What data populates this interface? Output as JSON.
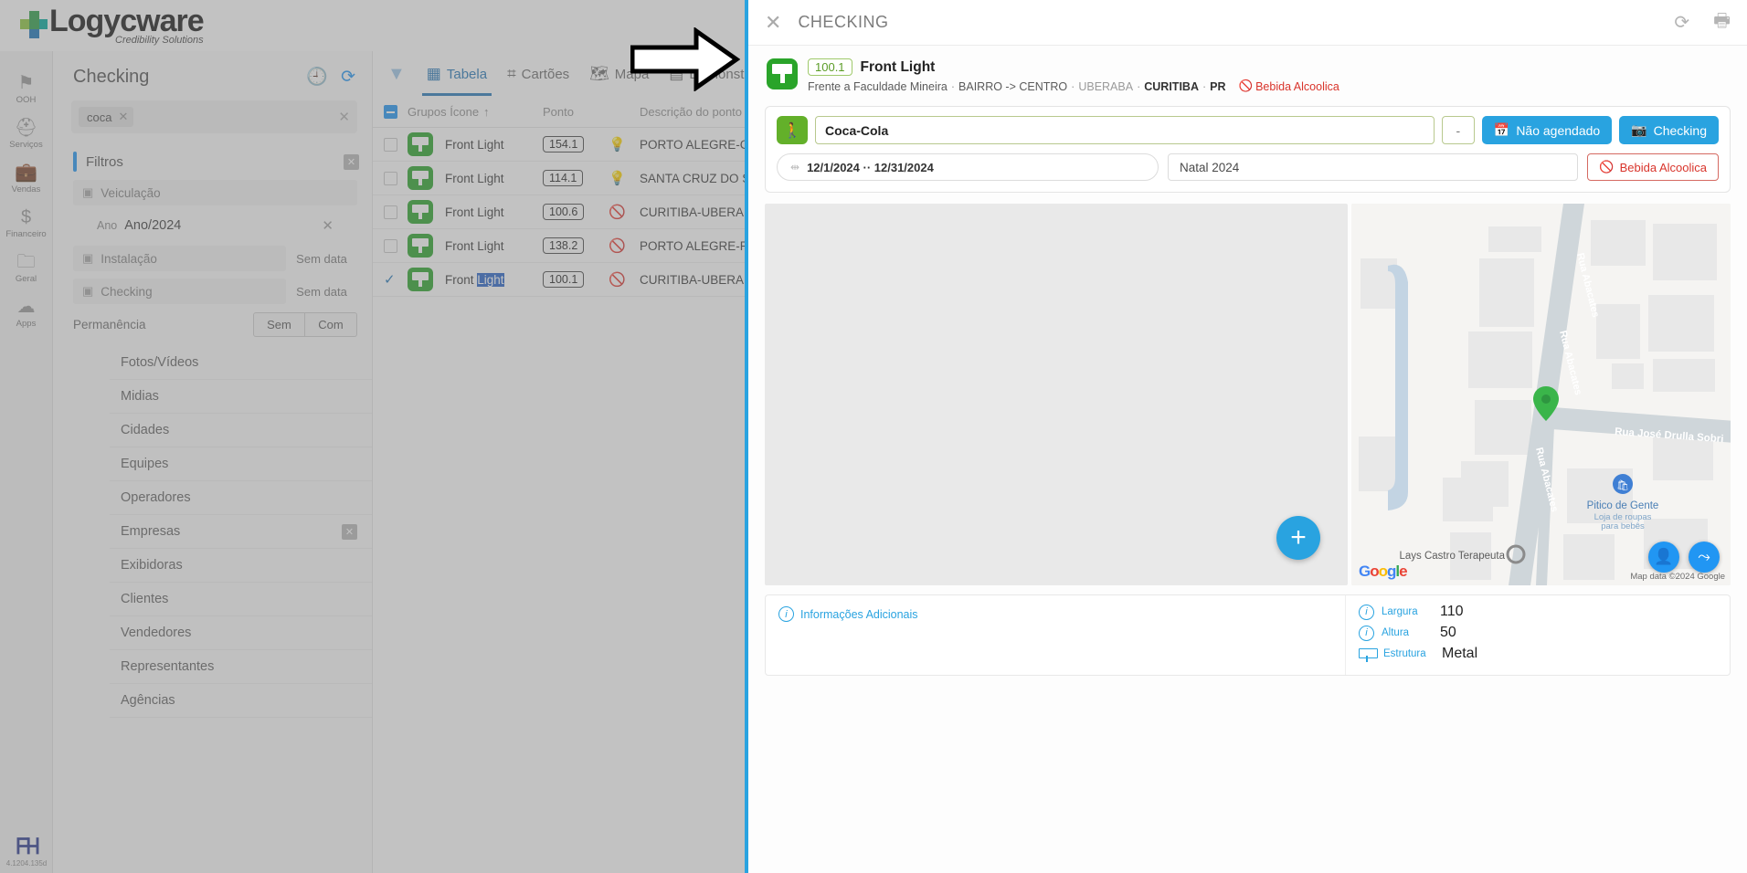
{
  "brand": {
    "name": "Logycware",
    "tagline": "Credibility Solutions"
  },
  "rail": {
    "items": [
      {
        "label": "OOH",
        "icon": "flag-icon"
      },
      {
        "label": "Serviços",
        "icon": "helmet-icon"
      },
      {
        "label": "Vendas",
        "icon": "briefcase-icon"
      },
      {
        "label": "Financeiro",
        "icon": "dollar-icon"
      },
      {
        "label": "Geral",
        "icon": "folder-icon"
      },
      {
        "label": "Apps",
        "icon": "cloud-plus-icon"
      }
    ],
    "version": "4.1204.135d"
  },
  "filters": {
    "page_title": "Checking",
    "history_icon": "history-icon",
    "refresh_icon": "refresh-icon",
    "search_chip": "coca",
    "search_clear": "✕",
    "section_title": "Filtros",
    "section_close": "✕",
    "veiculacao": {
      "label": "Veiculação",
      "ano_label": "Ano",
      "ano_value": "Ano/2024",
      "clear": "✕"
    },
    "instalacao": {
      "label": "Instalação",
      "value": "Sem data"
    },
    "checking": {
      "label": "Checking",
      "value": "Sem data"
    },
    "permanencia": {
      "label": "Permanência",
      "option_sem": "Sem",
      "option_com": "Com"
    },
    "accordions": [
      {
        "label": "Fotos/Vídeos",
        "has_close": false
      },
      {
        "label": "Midias",
        "has_close": false
      },
      {
        "label": "Cidades",
        "has_close": false
      },
      {
        "label": "Equipes",
        "has_close": false
      },
      {
        "label": "Operadores",
        "has_close": false
      },
      {
        "label": "Empresas",
        "has_close": true
      },
      {
        "label": "Exibidoras",
        "has_close": false
      },
      {
        "label": "Clientes",
        "has_close": false
      },
      {
        "label": "Vendedores",
        "has_close": false
      },
      {
        "label": "Representantes",
        "has_close": false
      },
      {
        "label": "Agências",
        "has_close": false
      }
    ]
  },
  "table": {
    "filter_icon": "funnel-icon",
    "tabs": [
      {
        "label": "Tabela",
        "icon": "grid-table-icon",
        "active": true
      },
      {
        "label": "Cartões",
        "icon": "cards-icon",
        "active": false
      },
      {
        "label": "Mapa",
        "icon": "map-icon",
        "active": false
      },
      {
        "label": "Demonstrativo",
        "icon": "layers-icon",
        "active": false
      }
    ],
    "columns": {
      "grupos": "Grupos Ícone",
      "sort": "↑",
      "ponto": "Ponto",
      "descricao": "Descrição do ponto"
    },
    "rows": [
      {
        "selected": false,
        "grupo": "Front Light",
        "ponto": "154.1",
        "status": "bulb",
        "descricao": "PORTO ALEGRE-CA"
      },
      {
        "selected": false,
        "grupo": "Front Light",
        "ponto": "114.1",
        "status": "bulb",
        "descricao": "SANTA CRUZ DO S"
      },
      {
        "selected": false,
        "grupo": "Front Light",
        "ponto": "100.6",
        "status": "blocked",
        "descricao": "CURITIBA-UBERAB"
      },
      {
        "selected": false,
        "grupo": "Front Light",
        "ponto": "138.2",
        "status": "blocked",
        "descricao": "PORTO ALEGRE-PE"
      },
      {
        "selected": true,
        "grupo_prefix": "Front ",
        "grupo_highlight": "Light",
        "grupo": "Front Light",
        "ponto": "100.1",
        "status": "blocked",
        "descricao": "CURITIBA-UBERAB"
      }
    ]
  },
  "panel": {
    "title": "CHECKING",
    "close_icon": "close-icon",
    "refresh_icon": "refresh-circle-icon",
    "print_icon": "printer-icon",
    "point": {
      "code": "100.1",
      "name": "Front Light",
      "address_main": "Frente a Faculdade Mineira",
      "sep1": "·",
      "neighborhood": "BAIRRO -> CENTRO",
      "sep2": "·",
      "city_muted": "UBERABA",
      "sep3": "·",
      "city_bold": "CURITIBA",
      "sep4": "·",
      "state": "PR",
      "restriction": "Bebida Alcoolica",
      "restriction_icon": "no-entry-icon"
    },
    "form": {
      "walk_icon": "walking-person-icon",
      "brand_value": "Coca-Cola",
      "dash_button": "-",
      "not_scheduled_button": "Não agendado",
      "not_scheduled_icon": "calendar-x-icon",
      "checking_button": "Checking",
      "checking_icon": "camera-icon",
      "date_range": "12/1/2024 ·· 12/31/2024",
      "date_icon": "date-range-icon",
      "campaign": "Natal 2024",
      "alcohol_button": "Bebida Alcoolica",
      "alcohol_icon": "no-entry-icon"
    },
    "media": {
      "add_photo_button": "+",
      "map": {
        "streets": [
          "Rua Abacates",
          "Rua Abacates",
          "Rua Abacates",
          "Rua José Drulla Sobri"
        ],
        "places": [
          {
            "name": "Pitico de Gente",
            "subtitle_1": "Loja de roupas",
            "subtitle_2": "para bebês"
          },
          {
            "name": "Lays Castro Terapeuta"
          }
        ],
        "google_logo": "Google",
        "attribution": "Map data ©2024 Google",
        "streetview_icon": "pegman-icon",
        "directions_icon": "route-icon"
      }
    },
    "info": {
      "additional_link": "Informações Adicionais",
      "specs": [
        {
          "icon": "info-circle-icon",
          "label": "Largura",
          "value": "110"
        },
        {
          "icon": "info-circle-icon",
          "label": "Altura",
          "value": "50"
        },
        {
          "icon": "structure-icon",
          "label": "Estrutura",
          "value": "Metal"
        }
      ]
    }
  },
  "annotations": {
    "arrow_right": "right-arrow-annotation",
    "arrow_down": "down-arrow-annotation"
  },
  "colors": {
    "accent": "#29a3e0",
    "green": "#2aa42a",
    "red": "#d9342b",
    "tab_active": "#2779b9"
  }
}
